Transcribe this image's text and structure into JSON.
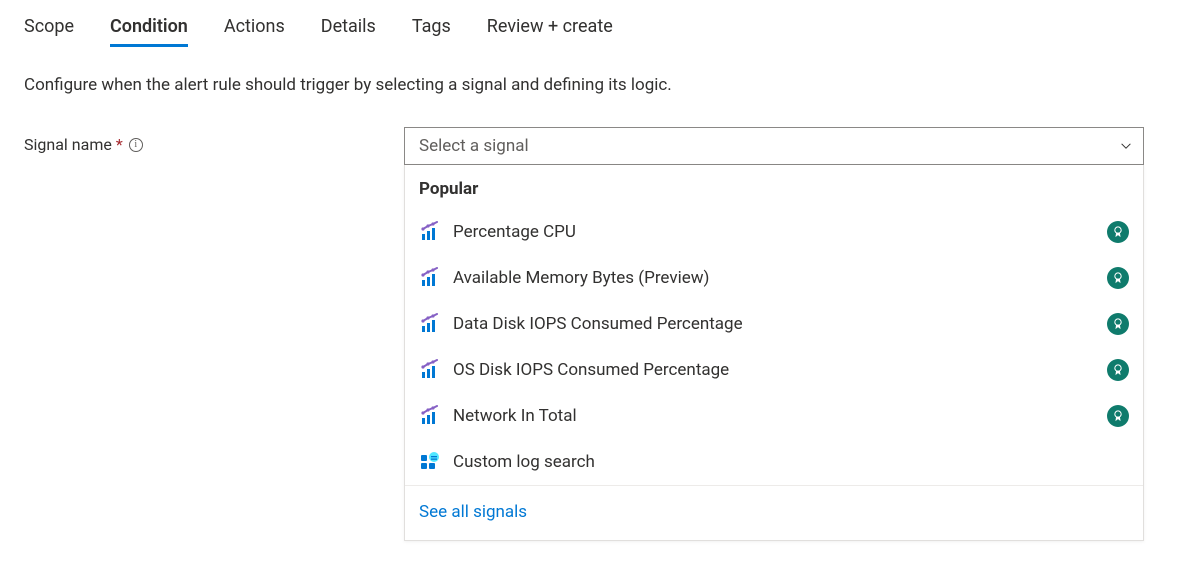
{
  "tabs": [
    {
      "label": "Scope",
      "active": false
    },
    {
      "label": "Condition",
      "active": true
    },
    {
      "label": "Actions",
      "active": false
    },
    {
      "label": "Details",
      "active": false
    },
    {
      "label": "Tags",
      "active": false
    },
    {
      "label": "Review + create",
      "active": false
    }
  ],
  "description": "Configure when the alert rule should trigger by selecting a signal and defining its logic.",
  "signal_field": {
    "label": "Signal name",
    "required_mark": "*",
    "placeholder": "Select a signal"
  },
  "dropdown": {
    "header": "Popular",
    "items": [
      {
        "label": "Percentage CPU",
        "type": "metric",
        "badge": true
      },
      {
        "label": "Available Memory Bytes (Preview)",
        "type": "metric",
        "badge": true
      },
      {
        "label": "Data Disk IOPS Consumed Percentage",
        "type": "metric",
        "badge": true
      },
      {
        "label": "OS Disk IOPS Consumed Percentage",
        "type": "metric",
        "badge": true
      },
      {
        "label": "Network In Total",
        "type": "metric",
        "badge": true
      },
      {
        "label": "Custom log search",
        "type": "log",
        "badge": false
      }
    ],
    "see_all": "See all signals"
  }
}
